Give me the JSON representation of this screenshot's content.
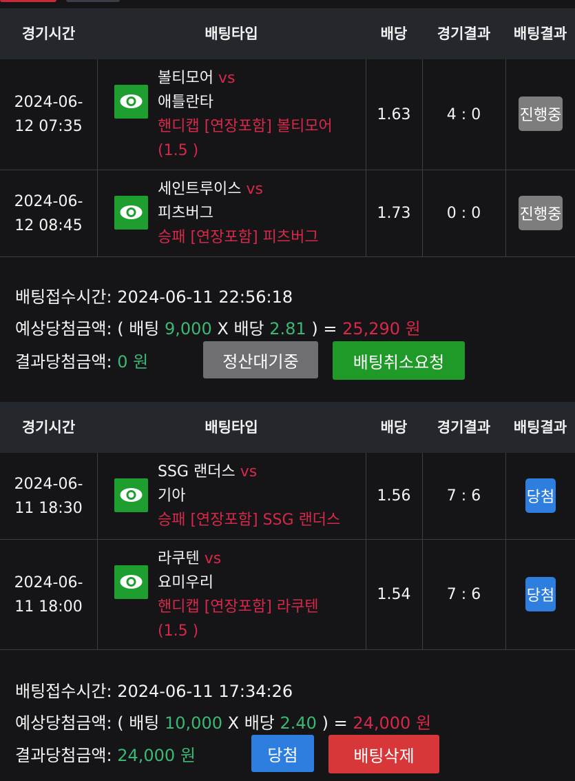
{
  "headers": {
    "time": "경기시간",
    "bet_type": "배팅타입",
    "odds": "배당",
    "game_result": "경기결과",
    "bet_result": "배팅결과"
  },
  "slips": [
    {
      "bets": [
        {
          "date": "2024-06-",
          "time": "12 07:35",
          "home": "볼티모어",
          "vs": "vs",
          "away": "애틀란타",
          "pick": "핸디캡 [연장포함] 볼티모어",
          "pick2": "(1.5 )",
          "odds": "1.63",
          "score": "4 : 0",
          "status": "진행중"
        },
        {
          "date": "2024-06-",
          "time": "12 08:45",
          "home": "세인트루이스",
          "vs": "vs",
          "away": "피츠버그",
          "pick": "승패 [연장포함] 피츠버그",
          "odds": "1.73",
          "score": "0 : 0",
          "status": "진행중"
        }
      ],
      "received_label": "배팅접수시간:",
      "received_time": "2024-06-11 22:56:18",
      "expected_label": "예상당첨금액:",
      "expected_open": "( 배팅",
      "stake": "9,000",
      "x_label": "X 배당",
      "total_odds": "2.81",
      "expected_close": ") =",
      "expected_amount": "25,290 원",
      "result_label": "결과당첨금액:",
      "result_amount": "0 원",
      "button1": "정산대기중",
      "button2": "배팅취소요청"
    },
    {
      "bets": [
        {
          "date": "2024-06-",
          "time": "11 18:30",
          "home": "SSG 랜더스",
          "vs": "vs",
          "away": "기아",
          "pick": "승패 [연장포함] SSG 랜더스",
          "odds": "1.56",
          "score": "7 : 6",
          "status": "당첨"
        },
        {
          "date": "2024-06-",
          "time": "11 18:00",
          "home": "라쿠텐",
          "vs": "vs",
          "away": "요미우리",
          "pick": "핸디캡 [연장포함] 라쿠텐",
          "pick2": "(1.5 )",
          "odds": "1.54",
          "score": "7 : 6",
          "status": "당첨"
        }
      ],
      "received_label": "배팅접수시간:",
      "received_time": "2024-06-11 17:34:26",
      "expected_label": "예상당첨금액:",
      "expected_open": "( 배팅",
      "stake": "10,000",
      "x_label": "X 배당",
      "total_odds": "2.40",
      "expected_close": ") =",
      "expected_amount": "24,000 원",
      "result_label": "결과당첨금액:",
      "result_amount": "24,000 원",
      "button1": "당첨",
      "button2": "배팅삭제"
    }
  ],
  "colors": {
    "accent_red": "#d8284a",
    "accent_green": "#3bb873",
    "eye_button": "#1e9e2e",
    "win_badge": "#2e7ee0"
  }
}
